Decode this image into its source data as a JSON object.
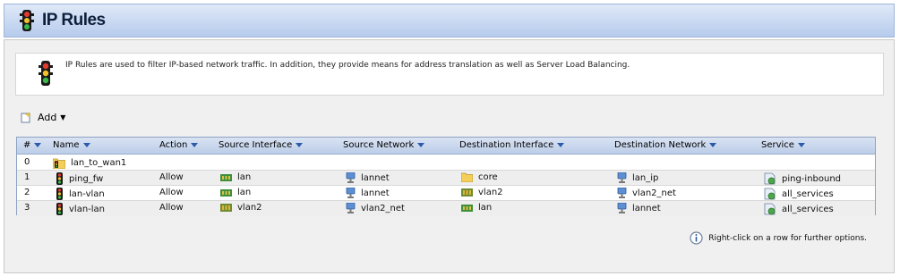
{
  "header": {
    "title": "IP Rules"
  },
  "info": {
    "description": "IP Rules are used to filter IP-based network traffic. In addition, they provide means for address translation as well as Server Load Balancing."
  },
  "toolbar": {
    "add_label": "Add"
  },
  "table": {
    "columns": [
      "#",
      "Name",
      "Action",
      "Source Interface",
      "Source Network",
      "Destination Interface",
      "Destination Network",
      "Service"
    ],
    "rows": [
      {
        "index": "0",
        "name": "lan_to_wan1",
        "name_icon": "folder-rule-icon",
        "action": "",
        "src_if": "",
        "src_if_icon": "",
        "src_net": "",
        "dst_if": "",
        "dst_if_icon": "",
        "dst_net": "",
        "service": ""
      },
      {
        "index": "1",
        "name": "ping_fw",
        "name_icon": "traffic-light-icon",
        "action": "Allow",
        "src_if": "lan",
        "src_if_icon": "ethernet-icon",
        "src_net": "lannet",
        "dst_if": "core",
        "dst_if_icon": "folder-icon",
        "dst_net": "lan_ip",
        "service": "ping-inbound"
      },
      {
        "index": "2",
        "name": "lan-vlan",
        "name_icon": "traffic-light-icon",
        "action": "Allow",
        "src_if": "lan",
        "src_if_icon": "ethernet-icon",
        "src_net": "lannet",
        "dst_if": "vlan2",
        "dst_if_icon": "vlan-icon",
        "dst_net": "vlan2_net",
        "service": "all_services"
      },
      {
        "index": "3",
        "name": "vlan-lan",
        "name_icon": "traffic-light-icon",
        "action": "Allow",
        "src_if": "vlan2",
        "src_if_icon": "vlan-icon",
        "src_net": "vlan2_net",
        "dst_if": "lan",
        "dst_if_icon": "ethernet-icon",
        "dst_net": "lannet",
        "service": "all_services"
      }
    ]
  },
  "hint": {
    "text": "Right-click on a row for further options."
  }
}
